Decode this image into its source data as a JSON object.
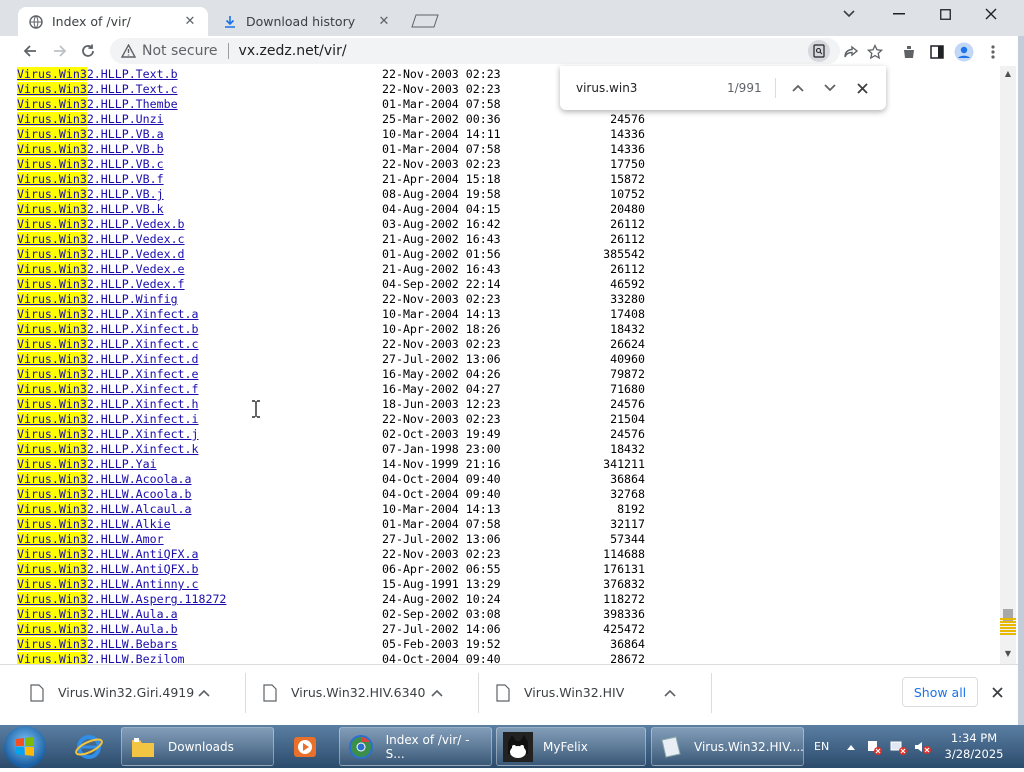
{
  "browser": {
    "tabs": [
      {
        "title": "Index of /vir/",
        "active": true
      },
      {
        "title": "Download history",
        "active": false
      }
    ],
    "address": {
      "security": "Not secure",
      "url": "vx.zedz.net/vir/"
    }
  },
  "find": {
    "query": "virus.win3",
    "count": "1/991"
  },
  "listing": [
    {
      "match": "Virus.Win3",
      "rest": "2.HLLP.Text.b",
      "date": "22-Nov-2003 02:23",
      "size": ""
    },
    {
      "match": "Virus.Win3",
      "rest": "2.HLLP.Text.c",
      "date": "22-Nov-2003 02:23",
      "size": ""
    },
    {
      "match": "Virus.Win3",
      "rest": "2.HLLP.Thembe",
      "date": "01-Mar-2004 07:58",
      "size": ""
    },
    {
      "match": "Virus.Win3",
      "rest": "2.HLLP.Unzi",
      "date": "25-Mar-2002 00:36",
      "size": "24576"
    },
    {
      "match": "Virus.Win3",
      "rest": "2.HLLP.VB.a",
      "date": "10-Mar-2004 14:11",
      "size": "14336"
    },
    {
      "match": "Virus.Win3",
      "rest": "2.HLLP.VB.b",
      "date": "01-Mar-2004 07:58",
      "size": "14336"
    },
    {
      "match": "Virus.Win3",
      "rest": "2.HLLP.VB.c",
      "date": "22-Nov-2003 02:23",
      "size": "17750"
    },
    {
      "match": "Virus.Win3",
      "rest": "2.HLLP.VB.f",
      "date": "21-Apr-2004 15:18",
      "size": "15872"
    },
    {
      "match": "Virus.Win3",
      "rest": "2.HLLP.VB.j",
      "date": "08-Aug-2004 19:58",
      "size": "10752"
    },
    {
      "match": "Virus.Win3",
      "rest": "2.HLLP.VB.k",
      "date": "04-Aug-2004 04:15",
      "size": "20480"
    },
    {
      "match": "Virus.Win3",
      "rest": "2.HLLP.Vedex.b",
      "date": "03-Aug-2002 16:42",
      "size": "26112"
    },
    {
      "match": "Virus.Win3",
      "rest": "2.HLLP.Vedex.c",
      "date": "21-Aug-2002 16:43",
      "size": "26112"
    },
    {
      "match": "Virus.Win3",
      "rest": "2.HLLP.Vedex.d",
      "date": "01-Aug-2002 01:56",
      "size": "385542"
    },
    {
      "match": "Virus.Win3",
      "rest": "2.HLLP.Vedex.e",
      "date": "21-Aug-2002 16:43",
      "size": "26112"
    },
    {
      "match": "Virus.Win3",
      "rest": "2.HLLP.Vedex.f",
      "date": "04-Sep-2002 22:14",
      "size": "46592"
    },
    {
      "match": "Virus.Win3",
      "rest": "2.HLLP.Winfig",
      "date": "22-Nov-2003 02:23",
      "size": "33280"
    },
    {
      "match": "Virus.Win3",
      "rest": "2.HLLP.Xinfect.a",
      "date": "10-Mar-2004 14:13",
      "size": "17408"
    },
    {
      "match": "Virus.Win3",
      "rest": "2.HLLP.Xinfect.b",
      "date": "10-Apr-2002 18:26",
      "size": "18432"
    },
    {
      "match": "Virus.Win3",
      "rest": "2.HLLP.Xinfect.c",
      "date": "22-Nov-2003 02:23",
      "size": "26624"
    },
    {
      "match": "Virus.Win3",
      "rest": "2.HLLP.Xinfect.d",
      "date": "27-Jul-2002 13:06",
      "size": "40960"
    },
    {
      "match": "Virus.Win3",
      "rest": "2.HLLP.Xinfect.e",
      "date": "16-May-2002 04:26",
      "size": "79872"
    },
    {
      "match": "Virus.Win3",
      "rest": "2.HLLP.Xinfect.f",
      "date": "16-May-2002 04:27",
      "size": "71680"
    },
    {
      "match": "Virus.Win3",
      "rest": "2.HLLP.Xinfect.h",
      "date": "18-Jun-2003 12:23",
      "size": "24576"
    },
    {
      "match": "Virus.Win3",
      "rest": "2.HLLP.Xinfect.i",
      "date": "22-Nov-2003 02:23",
      "size": "21504"
    },
    {
      "match": "Virus.Win3",
      "rest": "2.HLLP.Xinfect.j",
      "date": "02-Oct-2003 19:49",
      "size": "24576"
    },
    {
      "match": "Virus.Win3",
      "rest": "2.HLLP.Xinfect.k",
      "date": "07-Jan-1998 23:00",
      "size": "18432"
    },
    {
      "match": "Virus.Win3",
      "rest": "2.HLLP.Yai",
      "date": "14-Nov-1999 21:16",
      "size": "341211"
    },
    {
      "match": "Virus.Win3",
      "rest": "2.HLLW.Acoola.a",
      "date": "04-Oct-2004 09:40",
      "size": "36864"
    },
    {
      "match": "Virus.Win3",
      "rest": "2.HLLW.Acoola.b",
      "date": "04-Oct-2004 09:40",
      "size": "32768"
    },
    {
      "match": "Virus.Win3",
      "rest": "2.HLLW.Alcaul.a",
      "date": "10-Mar-2004 14:13",
      "size": "8192"
    },
    {
      "match": "Virus.Win3",
      "rest": "2.HLLW.Alkie",
      "date": "01-Mar-2004 07:58",
      "size": "32117"
    },
    {
      "match": "Virus.Win3",
      "rest": "2.HLLW.Amor",
      "date": "27-Jul-2002 13:06",
      "size": "57344"
    },
    {
      "match": "Virus.Win3",
      "rest": "2.HLLW.AntiQFX.a",
      "date": "22-Nov-2003 02:23",
      "size": "114688"
    },
    {
      "match": "Virus.Win3",
      "rest": "2.HLLW.AntiQFX.b",
      "date": "06-Apr-2002 06:55",
      "size": "176131"
    },
    {
      "match": "Virus.Win3",
      "rest": "2.HLLW.Antinny.c",
      "date": "15-Aug-1991 13:29",
      "size": "376832"
    },
    {
      "match": "Virus.Win3",
      "rest": "2.HLLW.Asperg.118272",
      "date": "24-Aug-2002 10:24",
      "size": "118272"
    },
    {
      "match": "Virus.Win3",
      "rest": "2.HLLW.Aula.a",
      "date": "02-Sep-2002 03:08",
      "size": "398336"
    },
    {
      "match": "Virus.Win3",
      "rest": "2.HLLW.Aula.b",
      "date": "27-Jul-2002 14:06",
      "size": "425472"
    },
    {
      "match": "Virus.Win3",
      "rest": "2.HLLW.Bebars",
      "date": "05-Feb-2003 19:52",
      "size": "36864"
    },
    {
      "match": "Virus.Win3",
      "rest": "2.HLLW.Bezilom",
      "date": "04-Oct-2004 09:40",
      "size": "28672"
    }
  ],
  "downloads": {
    "items": [
      "Virus.Win32.Giri.4919",
      "Virus.Win32.HIV.6340",
      "Virus.Win32.HIV"
    ],
    "show_all": "Show all"
  },
  "taskbar": {
    "tasks": [
      "Downloads",
      "Index of /vir/ - S...",
      "MyFelix",
      "Virus.Win32.HIV...."
    ],
    "lang": "EN",
    "time": "1:34 PM",
    "date": "3/28/2025"
  },
  "colors": {
    "highlight": "#ffff00",
    "link": "#1a0dab",
    "accent": "#1a73e8"
  }
}
